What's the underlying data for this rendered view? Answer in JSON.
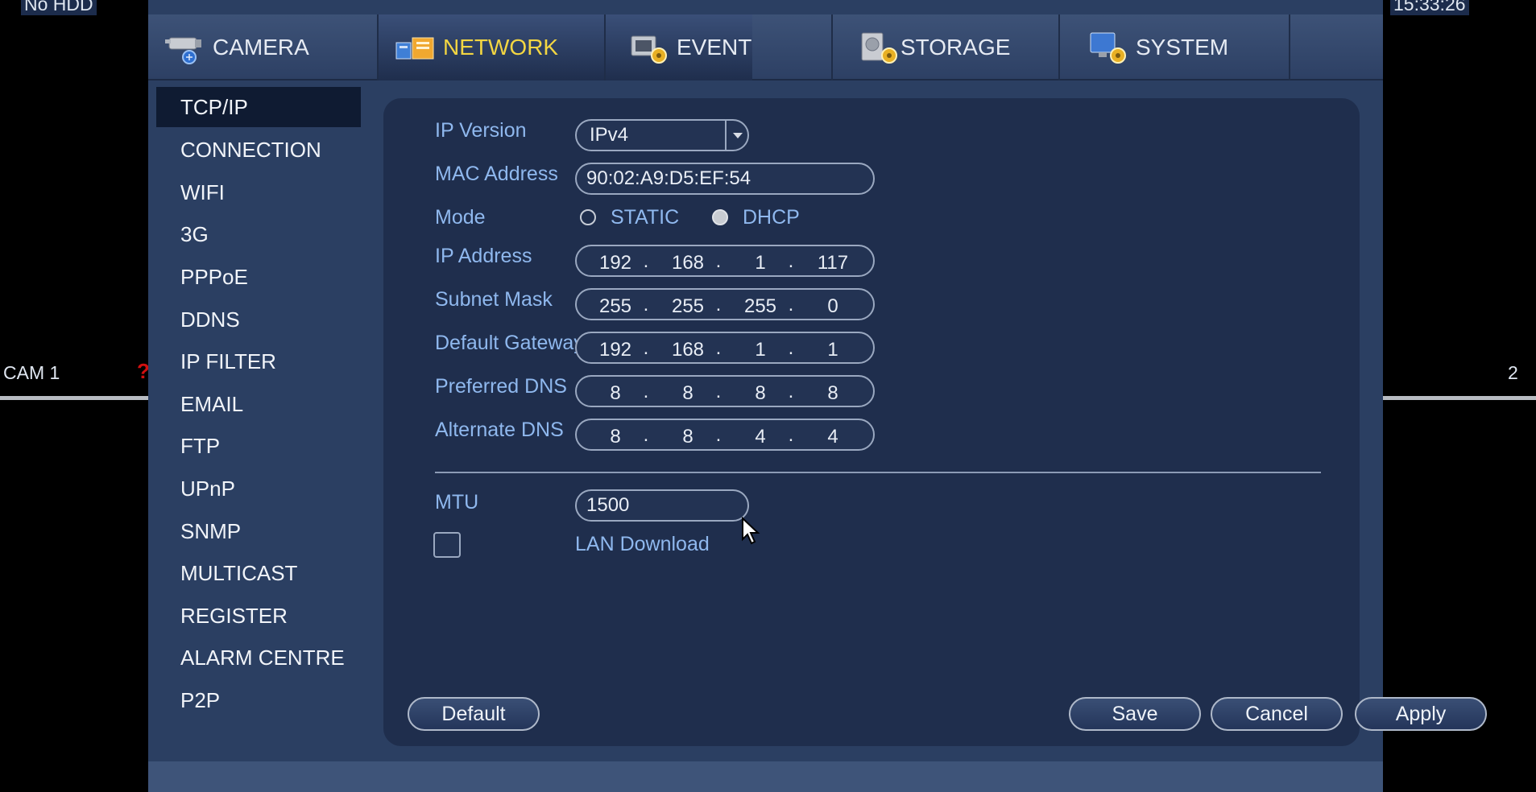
{
  "osd": {
    "hdd_status": "No HDD",
    "clock": "15:33:26",
    "cam1_label": "CAM 1",
    "cam1_alert": "?",
    "cam2_label": "2"
  },
  "tabs": [
    {
      "label": "CAMERA",
      "icon": "camera-icon",
      "active": false
    },
    {
      "label": "NETWORK",
      "icon": "network-icon",
      "active": true
    },
    {
      "label": "EVENT",
      "icon": "event-icon",
      "active": false
    },
    {
      "label": "STORAGE",
      "icon": "storage-icon",
      "active": false
    },
    {
      "label": "SYSTEM",
      "icon": "system-icon",
      "active": false
    }
  ],
  "side_menu": [
    {
      "label": "TCP/IP",
      "active": true
    },
    {
      "label": "CONNECTION"
    },
    {
      "label": "WIFI"
    },
    {
      "label": "3G"
    },
    {
      "label": "PPPoE"
    },
    {
      "label": "DDNS"
    },
    {
      "label": "IP FILTER"
    },
    {
      "label": "EMAIL"
    },
    {
      "label": "FTP"
    },
    {
      "label": "UPnP"
    },
    {
      "label": "SNMP"
    },
    {
      "label": "MULTICAST"
    },
    {
      "label": "REGISTER"
    },
    {
      "label": "ALARM CENTRE"
    },
    {
      "label": "P2P"
    }
  ],
  "form": {
    "ip_version": {
      "label": "IP Version",
      "value": "IPv4"
    },
    "mac_address": {
      "label": "MAC Address",
      "value": "90:02:A9:D5:EF:54"
    },
    "mode": {
      "label": "Mode",
      "static_label": "STATIC",
      "dhcp_label": "DHCP",
      "selected": "DHCP"
    },
    "ip_address": {
      "label": "IP Address",
      "octets": [
        "192",
        "168",
        "1",
        "117"
      ]
    },
    "subnet_mask": {
      "label": "Subnet Mask",
      "octets": [
        "255",
        "255",
        "255",
        "0"
      ]
    },
    "default_gateway": {
      "label": "Default Gateway",
      "octets": [
        "192",
        "168",
        "1",
        "1"
      ]
    },
    "preferred_dns": {
      "label": "Preferred DNS",
      "octets": [
        "8",
        "8",
        "8",
        "8"
      ]
    },
    "alternate_dns": {
      "label": "Alternate DNS",
      "octets": [
        "8",
        "8",
        "4",
        "4"
      ]
    },
    "mtu": {
      "label": "MTU",
      "value": "1500"
    },
    "lan_download": {
      "label": "LAN Download",
      "checked": false
    }
  },
  "buttons": {
    "default": "Default",
    "save": "Save",
    "cancel": "Cancel",
    "apply": "Apply"
  },
  "colors": {
    "active_tab_text": "#f3d642",
    "label_blue": "#8fb8ee",
    "panel_bg": "#1f2e4d"
  }
}
